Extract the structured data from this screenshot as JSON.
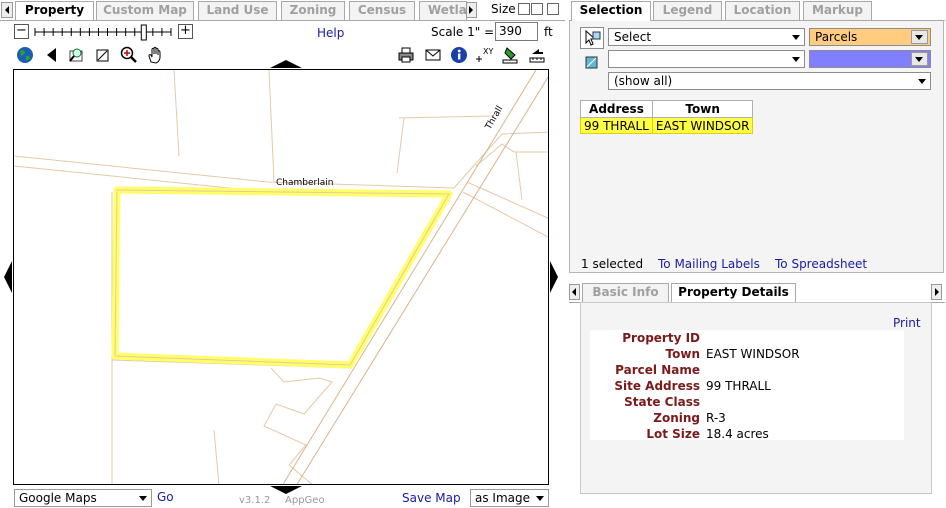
{
  "left_tabs": {
    "items": [
      {
        "label": "Property",
        "active": true
      },
      {
        "label": "Custom Map",
        "active": false
      },
      {
        "label": "Land Use",
        "active": false
      },
      {
        "label": "Zoning",
        "active": false
      },
      {
        "label": "Census",
        "active": false
      },
      {
        "label": "Wetla",
        "active": false
      }
    ],
    "size_label": "Size"
  },
  "toolbar": {
    "help_label": "Help",
    "scale_label": "Scale 1\" =",
    "scale_value": "390",
    "scale_unit": "ft",
    "zoom_slider_fraction": 0.8,
    "tools": [
      "globe-icon",
      "back-arrow-icon",
      "zoom-extent-icon",
      "zoom-box-icon",
      "zoom-in-icon",
      "pan-hand-icon"
    ],
    "right_tools": [
      "print-icon",
      "email-icon",
      "info-icon",
      "xy-coordinates-icon",
      "clear-highlight-icon",
      "measure-icon"
    ],
    "xy_label": "XY"
  },
  "map": {
    "road_labels": [
      "Chamberlain",
      "Thrall"
    ],
    "highlight_color": "#ffff66"
  },
  "map_footer": {
    "basemap_value": "Google Maps",
    "go_label": "Go",
    "version": "v3.1.2",
    "vendor": "AppGeo",
    "save_map_label": "Save Map",
    "save_format_value": "as Image"
  },
  "right_tabs": {
    "items": [
      {
        "label": "Selection",
        "active": true
      },
      {
        "label": "Legend",
        "active": false
      },
      {
        "label": "Location",
        "active": false
      },
      {
        "label": "Markup",
        "active": false
      }
    ]
  },
  "selection": {
    "mode_value": "Select",
    "layer_value": "Parcels",
    "layer_color": "#ffcc80",
    "second_value": "",
    "second_color": "#8080ff",
    "filter_value": "(show all)",
    "columns": [
      "Address",
      "Town"
    ],
    "rows": [
      [
        "99 THRALL",
        "EAST WINDSOR"
      ]
    ],
    "selected_count": "1 selected",
    "mailing_labels_link": "To Mailing Labels",
    "spreadsheet_link": "To Spreadsheet"
  },
  "detail_tabs": {
    "items": [
      {
        "label": "Basic Info",
        "active": false
      },
      {
        "label": "Property Details",
        "active": true
      }
    ]
  },
  "details": {
    "print_label": "Print",
    "fields": [
      {
        "label": "Property ID",
        "value": ""
      },
      {
        "label": "Town",
        "value": "EAST WINDSOR"
      },
      {
        "label": "Parcel Name",
        "value": ""
      },
      {
        "label": "Site Address",
        "value": "99 THRALL"
      },
      {
        "label": "State Class",
        "value": ""
      },
      {
        "label": "Zoning",
        "value": "R-3"
      },
      {
        "label": "Lot Size",
        "value": "18.4 acres"
      }
    ]
  }
}
